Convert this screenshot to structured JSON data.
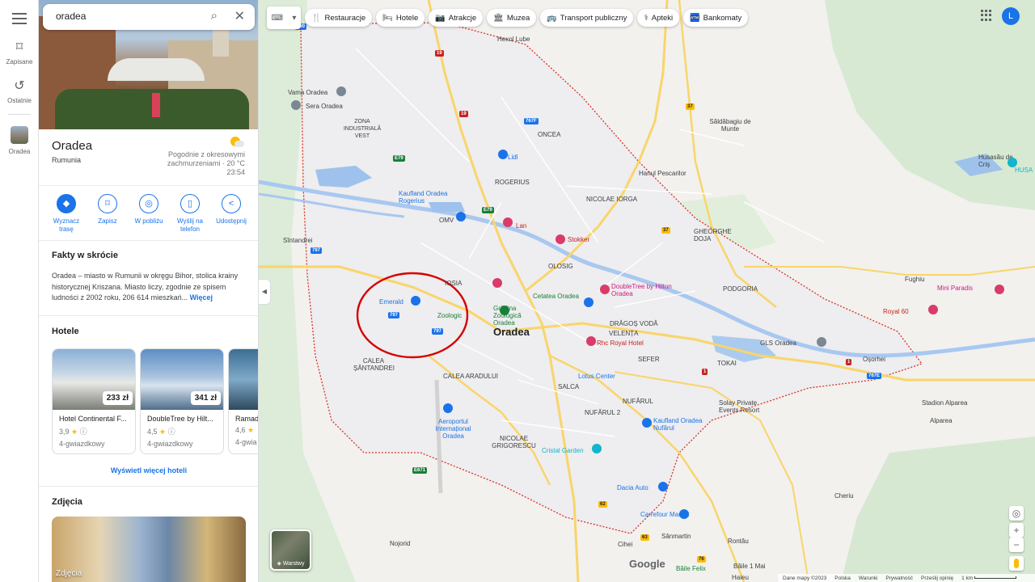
{
  "search": {
    "value": "oradea"
  },
  "rail": {
    "saved": "Zapisane",
    "recent": "Ostatnie",
    "place": "Oradea"
  },
  "place": {
    "name": "Oradea",
    "country": "Rumunia",
    "weather_text": "Pogodnie z okresowymi zachmurzeniami · 20 °C",
    "time": "23:54"
  },
  "actions": [
    {
      "label": "Wyznacz trasę"
    },
    {
      "label": "Zapisz"
    },
    {
      "label": "W pobliżu"
    },
    {
      "label": "Wyślij na telefon"
    },
    {
      "label": "Udostępnij"
    }
  ],
  "facts": {
    "heading": "Fakty w skrócie",
    "text": "Oradea – miasto w Rumunii w okręgu Bihor, stolica krainy historycznej Kriszana. Miasto liczy, zgodnie ze spisem ludności z 2002 roku, 206 614 mieszkań...",
    "more": "Więcej"
  },
  "hotels": {
    "heading": "Hotele",
    "items": [
      {
        "price": "233 zł",
        "name": "Hotel Continental F...",
        "rating": "3,9",
        "class": "4-gwiazdkowy"
      },
      {
        "price": "341 zł",
        "name": "DoubleTree by Hilt...",
        "rating": "4,5",
        "class": "4-gwiazdkowy"
      },
      {
        "price": "",
        "name": "Ramad",
        "rating": "4,6",
        "class": "4-gwia"
      }
    ],
    "more": "Wyświetl więcej hoteli"
  },
  "photos": {
    "heading": "Zdjęcia",
    "label": "Zdjęcia"
  },
  "chips": [
    {
      "icon": "fork-knife-icon",
      "glyph": "🍴",
      "label": "Restauracje"
    },
    {
      "icon": "bed-icon",
      "glyph": "🛏",
      "label": "Hotele"
    },
    {
      "icon": "camera-icon",
      "glyph": "📷",
      "label": "Atrakcje"
    },
    {
      "icon": "museum-icon",
      "glyph": "🏛",
      "label": "Muzea"
    },
    {
      "icon": "bus-icon",
      "glyph": "🚌",
      "label": "Transport publiczny"
    },
    {
      "icon": "pharmacy-icon",
      "glyph": "⚕",
      "label": "Apteki"
    },
    {
      "icon": "atm-icon",
      "glyph": "🏧",
      "label": "Bankomaty"
    }
  ],
  "user": {
    "initial": "L"
  },
  "layers": {
    "label": "Warstwy"
  },
  "brand": {
    "logo": "Google"
  },
  "footer": {
    "data": "Dane mapy ©2023",
    "country": "Polska",
    "terms": "Warunki",
    "privacy": "Prywatność",
    "feedback": "Prześlij opinię",
    "scale": "1 km"
  },
  "map_labels": {
    "city": "Oradea",
    "places": [
      "Hexol Lube",
      "Vama Oradea",
      "Sera Oradea",
      "ZONA INDUSTRIALĂ VEST",
      "ONCEA",
      "Săldăbagiu de Munte",
      "Lidl",
      "ROGERIUS",
      "Hanul Pescarilor",
      "Kaufland Oradea Rogerius",
      "NICOLAE IORGA",
      "Husasău de Criș",
      "OMV",
      "Lan",
      "Stokker",
      "Sîntandrei",
      "GHEORGHE DOJA",
      "OLOSIG",
      "Fughiu",
      "IOSIA",
      "DoubleTree by Hilton Oradea",
      "Emerald",
      "Grădina Zoologică Oradea",
      "Cetatea Oradea",
      "PODGORIA",
      "Mini Paradis",
      "Zoologic",
      "DRĂGOȘ VODĂ",
      "VELENȚA",
      "Royal 60",
      "Rhc Royal Hotel",
      "CALEA ȘĂNTANDREI",
      "CALEA ARADULUI",
      "GLS Oradea",
      "Oșorhei",
      "TOKAI",
      "SEFER",
      "Lotus Center",
      "SALCA",
      "Aeroportul Internațional Oradea",
      "NUFĂRUL",
      "Kaufland Oradea Nufărul",
      "Solay Private Events Resort",
      "Stadion Alparea",
      "Alparea",
      "NUFĂRUL 2",
      "NICOLAE GRIGORESCU",
      "Cristal Garden",
      "Dacia Auto",
      "Carrefour Market",
      "Cheriu",
      "Sânmartin",
      "Rontău",
      "Nojorid",
      "Cihei",
      "Băile 1 Mai",
      "Băile Felix",
      "Haieu",
      "HUSA"
    ]
  },
  "colors": {
    "accent": "#1a73e8",
    "boundary": "#d93025",
    "highlight_circle": "#d50000"
  }
}
